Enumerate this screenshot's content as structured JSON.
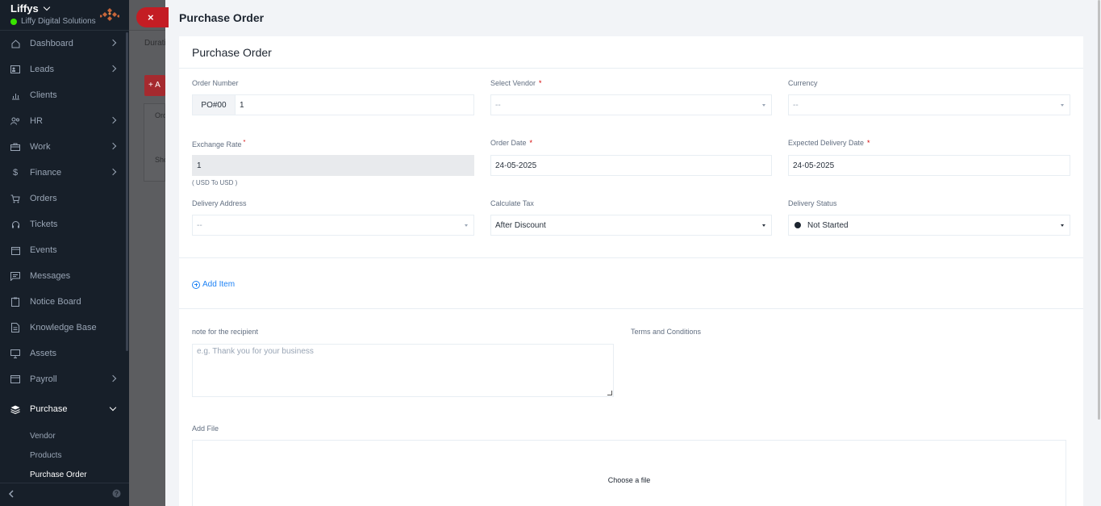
{
  "sidebar": {
    "company": "Liffys",
    "workspace": "Liffy Digital Solutions",
    "status_color": "#39e500",
    "items": [
      {
        "label": "Dashboard",
        "icon": "house-icon",
        "has_arrow": true
      },
      {
        "label": "Leads",
        "icon": "id-card-icon",
        "has_arrow": true
      },
      {
        "label": "Clients",
        "icon": "bar-chart-icon",
        "has_arrow": false
      },
      {
        "label": "HR",
        "icon": "people-icon",
        "has_arrow": true
      },
      {
        "label": "Work",
        "icon": "briefcase-icon",
        "has_arrow": true
      },
      {
        "label": "Finance",
        "icon": "dollar-icon",
        "has_arrow": true
      },
      {
        "label": "Orders",
        "icon": "cart-icon",
        "has_arrow": false
      },
      {
        "label": "Tickets",
        "icon": "headset-icon",
        "has_arrow": false
      },
      {
        "label": "Events",
        "icon": "calendar-icon",
        "has_arrow": false
      },
      {
        "label": "Messages",
        "icon": "message-icon",
        "has_arrow": false
      },
      {
        "label": "Notice Board",
        "icon": "clipboard-icon",
        "has_arrow": false
      },
      {
        "label": "Knowledge Base",
        "icon": "document-icon",
        "has_arrow": false
      },
      {
        "label": "Assets",
        "icon": "monitor-icon",
        "has_arrow": false
      },
      {
        "label": "Payroll",
        "icon": "wallet-icon",
        "has_arrow": true
      }
    ],
    "active_item": {
      "label": "Purchase",
      "icon": "layers-icon"
    },
    "sub_items": [
      "Vendor",
      "Products",
      "Purchase Order"
    ]
  },
  "background": {
    "close_label": "×",
    "tab_label": "Durati",
    "add_label": "+ A",
    "row1": "Ord",
    "row2": "Sho"
  },
  "panel": {
    "title": "Purchase Order",
    "card_title": "Purchase Order",
    "fields": {
      "order_number": {
        "label": "Order Number",
        "prefix": "PO#00",
        "value": "1"
      },
      "vendor": {
        "label": "Select Vendor",
        "required": "*",
        "value": "--"
      },
      "currency": {
        "label": "Currency",
        "value": "--"
      },
      "exchange_rate": {
        "label": "Exchange Rate",
        "required": "*",
        "value": "1",
        "help": "( USD To USD )"
      },
      "order_date": {
        "label": "Order Date",
        "required": "*",
        "value": "24-05-2025"
      },
      "delivery_date": {
        "label": "Expected Delivery Date",
        "required": "*",
        "value": "24-05-2025"
      },
      "delivery_address": {
        "label": "Delivery Address",
        "value": "--"
      },
      "calculate_tax": {
        "label": "Calculate Tax",
        "value": "After Discount"
      },
      "delivery_status": {
        "label": "Delivery Status",
        "value": "Not Started"
      }
    },
    "add_item_label": "Add Item",
    "note_label": "note for the recipient",
    "note_placeholder": "e.g. Thank you for your business",
    "terms_label": "Terms and Conditions",
    "add_file_label": "Add File",
    "choose_file_label": "Choose a file"
  }
}
